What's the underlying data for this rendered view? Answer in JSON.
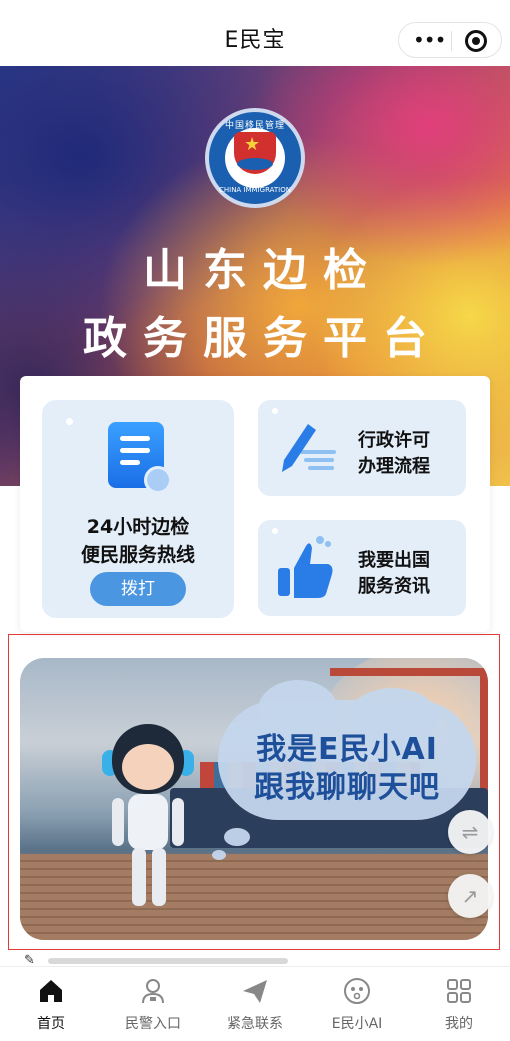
{
  "nav": {
    "title": "E民宝"
  },
  "hero": {
    "emblem_top": "中国移民管理",
    "emblem_bottom": "CHINA IMMIGRATION",
    "title_line1": "山东边检",
    "title_line2": "政务服务平台"
  },
  "services": {
    "hotline": {
      "line1": "24小时边检",
      "line2": "便民服务热线",
      "button": "拨打"
    },
    "permit": {
      "line1": "行政许可",
      "line2": "办理流程"
    },
    "abroad": {
      "line1": "我要出国",
      "line2": "服务资讯"
    }
  },
  "ai_banner": {
    "line1": "我是E民小AI",
    "line2": "跟我聊聊天吧"
  },
  "tabs": [
    {
      "label": "首页",
      "icon": "home-icon",
      "active": true
    },
    {
      "label": "民警入口",
      "icon": "police-icon",
      "active": false
    },
    {
      "label": "紧急联系",
      "icon": "paper-plane-icon",
      "active": false
    },
    {
      "label": "E民小AI",
      "icon": "ai-face-icon",
      "active": false
    },
    {
      "label": "我的",
      "icon": "grid-icon",
      "active": false
    }
  ],
  "colors": {
    "accent": "#4a96e0",
    "card_bg": "#e4eef9",
    "ai_text": "#1d4f9a",
    "highlight_border": "#e23a34"
  }
}
